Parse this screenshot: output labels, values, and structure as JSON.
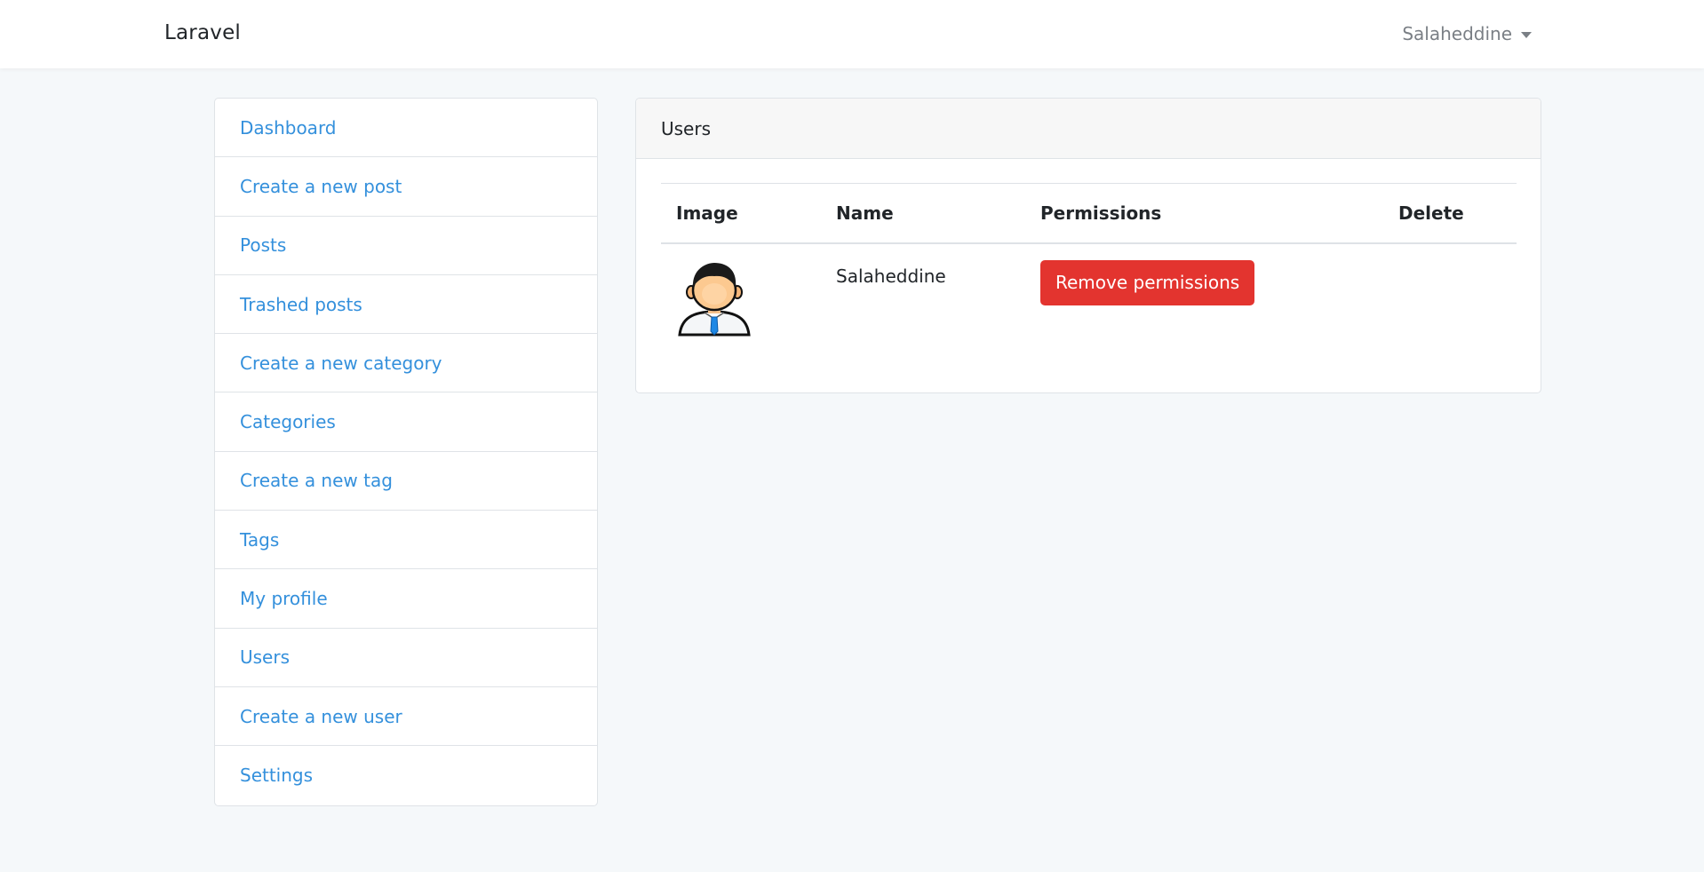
{
  "navbar": {
    "brand": "Laravel",
    "user_name": "Salaheddine"
  },
  "sidebar": {
    "items": [
      {
        "label": "Dashboard"
      },
      {
        "label": "Create a new post"
      },
      {
        "label": "Posts"
      },
      {
        "label": "Trashed posts"
      },
      {
        "label": "Create a new category"
      },
      {
        "label": "Categories"
      },
      {
        "label": "Create a new tag"
      },
      {
        "label": "Tags"
      },
      {
        "label": "My profile"
      },
      {
        "label": "Users"
      },
      {
        "label": "Create a new user"
      },
      {
        "label": "Settings"
      }
    ]
  },
  "card": {
    "title": "Users",
    "table": {
      "headers": [
        "Image",
        "Name",
        "Permissions",
        "Delete"
      ],
      "rows": [
        {
          "avatar_icon": "user-avatar-icon",
          "name": "Salaheddine",
          "permission_button": "Remove permissions"
        }
      ]
    }
  },
  "colors": {
    "link": "#3490dc",
    "danger": "#e3342f",
    "background": "#f5f8fa"
  }
}
